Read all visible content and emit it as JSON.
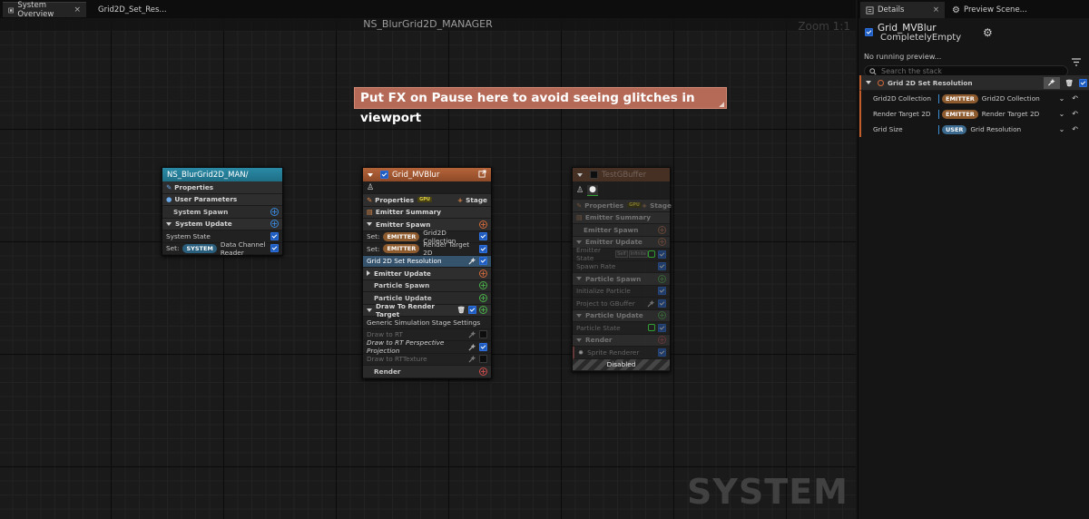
{
  "tabs": [
    {
      "label": "System Overview",
      "close": "×"
    },
    {
      "label": "Grid2D_Set_Res..."
    }
  ],
  "graph": {
    "title": "NS_BlurGrid2D_MANAGER",
    "zoom": "Zoom 1:1",
    "watermark": "SYSTEM",
    "comment": "Put FX on Pause here to avoid seeing glitches in viewport"
  },
  "system_node": {
    "title": "NS_BlurGrid2D_MAN/",
    "properties": "Properties",
    "user_parameters": "User Parameters",
    "system_spawn": "System Spawn",
    "system_update": "System Update",
    "system_state": "System State",
    "set_label": "Set:",
    "set_pill": "SYSTEM",
    "set_text": "Data Channel Reader"
  },
  "emitter_node": {
    "title": "Grid_MVBlur",
    "properties": "Properties",
    "properties_tag": "GPU",
    "stage": "Stage",
    "emitter_summary": "Emitter Summary",
    "emitter_spawn": "Emitter Spawn",
    "set1_label": "Set:",
    "set1_pill": "EMITTER",
    "set1_text": "Grid2D Collection",
    "set2_label": "Set:",
    "set2_pill": "EMITTER",
    "set2_text": "Render Target 2D",
    "grid_set_res": "Grid 2D Set Resolution",
    "emitter_update": "Emitter Update",
    "particle_spawn": "Particle Spawn",
    "particle_update": "Particle Update",
    "draw_rt": "Draw To Render Target",
    "generic_sim": "Generic Simulation Stage Settings",
    "draw_to_rt": "Draw to RT",
    "draw_rt_persp": "Draw to RT Perspective Projection",
    "draw_rt_texture": "Draw to RTTexture",
    "render": "Render"
  },
  "gbuffer_node": {
    "title": "TestGBuffer",
    "properties": "Properties",
    "properties_tag": "GPU",
    "stage": "Stage",
    "emitter_summary": "Emitter Summary",
    "emitter_spawn": "Emitter Spawn",
    "emitter_update": "Emitter Update",
    "emitter_state": "Emitter State",
    "self_tag": "Self",
    "infinite_tag": "Infinite",
    "spawn_rate": "Spawn Rate",
    "particle_spawn": "Particle Spawn",
    "initialize_particle": "Initialize Particle",
    "project_to_gbuffer": "Project to GBuffer",
    "particle_update": "Particle Update",
    "particle_state": "Particle State",
    "render": "Render",
    "sprite_renderer": "Sprite Renderer",
    "disabled": "Disabled"
  },
  "panel": {
    "tabs": [
      {
        "label": "Details",
        "close": "×"
      },
      {
        "label": "Preview Scene..."
      }
    ],
    "name": "Grid_MVBlur",
    "subtitle": "CompletelyEmpty",
    "no_preview": "No running preview...",
    "search_placeholder": "Search the stack",
    "module_title": "Grid 2D Set Resolution",
    "params": [
      {
        "label": "Grid2D Collection",
        "pill": "EMITTER",
        "value": "Grid2D Collection"
      },
      {
        "label": "Render Target 2D",
        "pill": "EMITTER",
        "value": "Render Target 2D"
      },
      {
        "label": "Grid Size",
        "pill": "USER",
        "value": "Grid Resolution"
      }
    ]
  },
  "colors": {
    "system_header": "#1f6f86",
    "emitter_header": "#a0522d",
    "gbuffer_header": "#4a3224",
    "accent_blue": "#1e5cc0",
    "comment_bg": "#b46a57",
    "stack_accent": "#c25d2c"
  }
}
